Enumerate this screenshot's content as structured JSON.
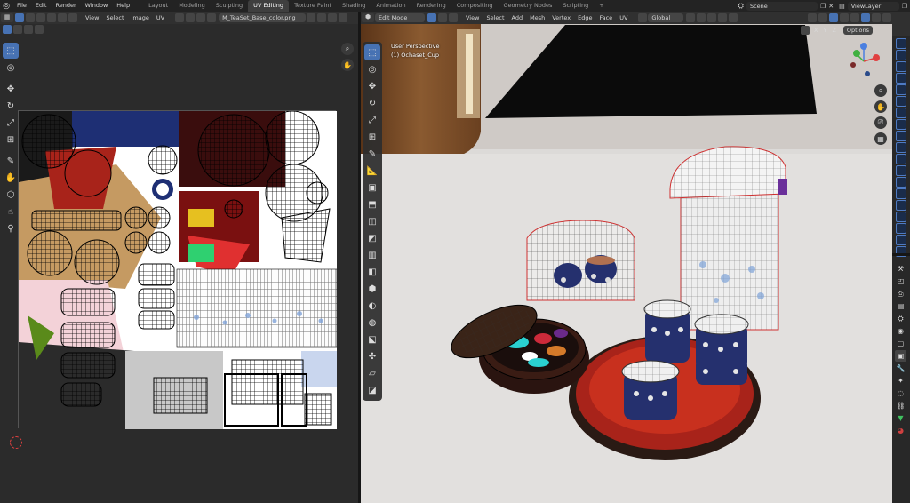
{
  "topbar": {
    "menus": [
      "File",
      "Edit",
      "Render",
      "Window",
      "Help"
    ],
    "workspaces": [
      "Layout",
      "Modeling",
      "Sculpting",
      "UV Editing",
      "Texture Paint",
      "Shading",
      "Animation",
      "Rendering",
      "Compositing",
      "Geometry Nodes",
      "Scripting"
    ],
    "active_workspace": "UV Editing",
    "add_tab": "+",
    "scene": "Scene",
    "view_layer": "ViewLayer"
  },
  "uv_editor": {
    "menus": [
      "View",
      "Select",
      "Image",
      "UV"
    ],
    "image_name": "M_TeaSet_Base_color.png"
  },
  "viewport": {
    "mode": "Edit Mode",
    "menus": [
      "View",
      "Select",
      "Add",
      "Mesh",
      "Vertex",
      "Edge",
      "Face",
      "UV"
    ],
    "orientation": "Global",
    "axes": [
      "X",
      "Y",
      "Z"
    ],
    "options": "Options",
    "overlay_title": "User Perspective",
    "overlay_object": "(1) Ochaset_Cup",
    "gizmo_labels": [
      "Z",
      "Y",
      "X"
    ]
  },
  "colors": {
    "accent": "#4772b3",
    "header": "#303030",
    "tray_red": "#a8231a",
    "cup_blue": "#25306e",
    "selection_red": "#e03030"
  }
}
